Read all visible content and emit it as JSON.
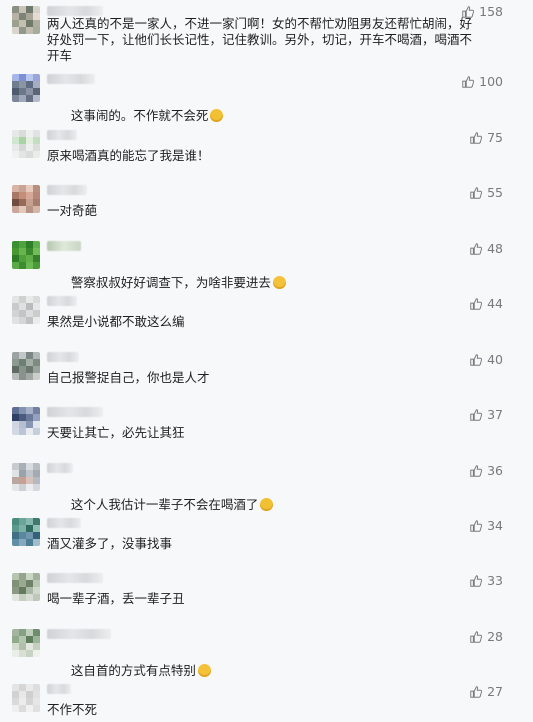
{
  "comments": [
    {
      "text": "两人还真的不是一家人，不进一家门啊！女的不帮忙劝阻男友还帮忙胡闹，好好处罚一下，让他们长长记性，记住教训。另外，切记，开车不喝酒，喝酒不开车",
      "likes": "158",
      "emoji": ""
    },
    {
      "text": "这事闹的。不作就不会死",
      "likes": "100",
      "emoji": "thinking-face"
    },
    {
      "text": "原来喝酒真的能忘了我是谁！",
      "likes": "75",
      "emoji": ""
    },
    {
      "text": "一对奇葩",
      "likes": "55",
      "emoji": ""
    },
    {
      "text": "警察叔叔好好调查下，为啥非要进去",
      "likes": "48",
      "emoji": "grinning-face"
    },
    {
      "text": "果然是小说都不敢这么编",
      "likes": "44",
      "emoji": ""
    },
    {
      "text": "自己报警捉自己，你也是人才",
      "likes": "40",
      "emoji": ""
    },
    {
      "text": "天要让其亡，必先让其狂",
      "likes": "37",
      "emoji": ""
    },
    {
      "text": "这个人我估计一辈子不会在喝酒了",
      "likes": "36",
      "emoji": "thinking-face"
    },
    {
      "text": "酒又灌多了，没事找事",
      "likes": "34",
      "emoji": ""
    },
    {
      "text": "喝一辈子酒，丢一辈子丑",
      "likes": "33",
      "emoji": ""
    },
    {
      "text": "这自首的方式有点特别",
      "likes": "28",
      "emoji": "grinning-face"
    },
    {
      "text": "不作不死",
      "likes": "27",
      "emoji": ""
    }
  ],
  "colors": {
    "background": "#f7f8fa",
    "text": "#1f1f1f",
    "like": "#7a7a7a"
  }
}
